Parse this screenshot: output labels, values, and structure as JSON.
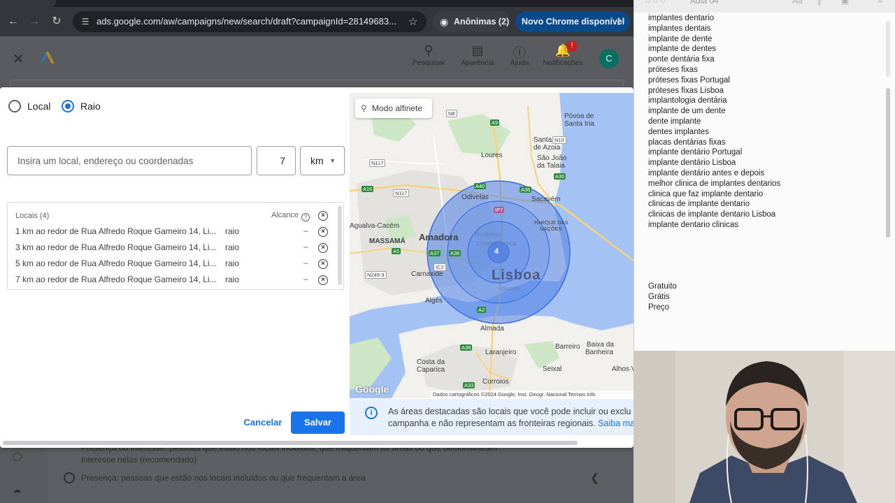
{
  "browser": {
    "url": "ads.google.com/aw/campaigns/new/search/draft?campaignId=28149683...",
    "incognito_label": "Anônimas (2)",
    "update_label": "Novo Chrome disponível"
  },
  "ads_header": {
    "tools": [
      {
        "label": "Pesquisar"
      },
      {
        "label": "Aparência"
      },
      {
        "label": "Ajuda"
      },
      {
        "label": "Notificações",
        "badge": "!"
      }
    ],
    "avatar_letter": "C"
  },
  "background_page": {
    "option_partial": "Presença ou interesse: pessoas que estão nos locais incluídos, que frequentam as áreas ou que demonstraram",
    "option_partial_2": "interesse nelas (recomendado)",
    "option_presence": "Presença: pessoas que estão nos locais incluídos ou que frequentam a área"
  },
  "modal": {
    "radio_local": "Local",
    "radio_raio": "Raio",
    "selected": "Raio",
    "search_placeholder": "Insira um local, endereço ou coordenadas",
    "radius_value": "7",
    "unit": "km",
    "locations_header": "Locais (4)",
    "reach_header": "Alcance",
    "locations": [
      {
        "text": "1 km ao redor de Rua Alfredo Roque Gameiro 14, Li...",
        "type": "raio",
        "reach": "–"
      },
      {
        "text": "3 km ao redor de Rua Alfredo Roque Gameiro 14, Li...",
        "type": "raio",
        "reach": "–"
      },
      {
        "text": "5 km ao redor de Rua Alfredo Roque Gameiro 14, Li...",
        "type": "raio",
        "reach": "–"
      },
      {
        "text": "7 km ao redor de Rua Alfredo Roque Gameiro 14, Li...",
        "type": "raio",
        "reach": "–"
      }
    ],
    "cancel_label": "Cancelar",
    "save_label": "Salvar"
  },
  "map": {
    "pin_mode_label": "Modo alfinete",
    "marker_count": "4",
    "labels": {
      "povoa": "Póvoa de",
      "santa_iria": "Santa Iria",
      "santa_iria2": "de Azoia",
      "loures": "Loures",
      "sao_joao": "São João",
      "sao_joao2": "da Talaia",
      "odivelas": "Odivelas",
      "sacavem": "Sacavém",
      "parque": "PARQUE DAS",
      "parque2": "NAÇÕES",
      "agualva": "Agualva-Cacém",
      "massama": "MASSAMÁ",
      "amadora": "Amadora",
      "lisboa": "Lisboa",
      "carnaxide": "Carnaxide",
      "alges": "Algés",
      "almada": "Almada",
      "laranjeiro": "Laranjeiro",
      "barreiro": "Barreiro",
      "baixa": "Baixa da",
      "baixa2": "Banheira",
      "costa": "Costa da",
      "costa2": "Caparica",
      "seixal": "Seixal",
      "corroios": "Corroios",
      "alhos": "Alhos V",
      "telheiras": "TELHEIRAS",
      "campo_grande": "CAMPO GRANDE",
      "chiado": "CHIADO"
    },
    "roads": [
      "N8",
      "A9",
      "N10",
      "N117",
      "A16",
      "A40",
      "A36",
      "A30",
      "IP7",
      "N117",
      "A37",
      "A36",
      "N249-3",
      "A5",
      "A2",
      "A38",
      "A33",
      "IC2"
    ],
    "attribution": "Dados cartográficos ©2024 Google, Inst. Geogr. Nacional   Termos   Info",
    "google": "Google"
  },
  "info": {
    "text1": "As áreas destacadas são locais que você pode incluir ou exclu",
    "text2": "campanha e não representam as fronteiras regionais.",
    "link": "Saiba ma"
  },
  "notes": {
    "title": "Aula 04",
    "keywords": [
      "implantes dentario",
      "implantes dentais",
      "implante de dente",
      "implante de dentes",
      "ponte dentária fixa",
      "próteses fixas",
      "próteses fixas Portugal",
      "próteses fixas Lisboa",
      "implantologia dentária",
      "implante de um dente",
      "dente implante",
      "dentes implantes",
      "placas dentárias fixas",
      "implante dentário Portugal",
      "implante dentário Lisboa",
      "implante dentário antes e depois",
      "melhor clinica de implantes dentarios",
      "clinica que faz implante dentario",
      "clinicas de implante dentario",
      "clinicas de implante dentario Lisboa",
      "implante dentario clinicas"
    ],
    "negatives": [
      "Gratuito",
      "Grátis",
      "Preço"
    ]
  }
}
